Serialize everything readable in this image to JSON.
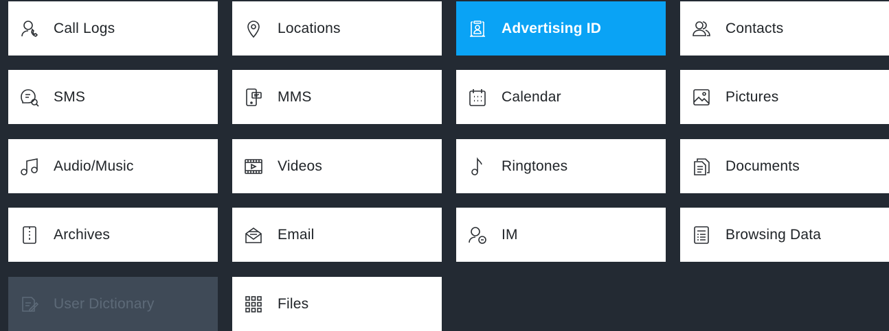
{
  "colors": {
    "background": "#232a33",
    "tile": "#ffffff",
    "selected": "#0aa3f5",
    "disabled": "#3f4a57"
  },
  "tiles": [
    {
      "label": "Call Logs",
      "icon": "call-logs-icon",
      "state": "normal"
    },
    {
      "label": "Locations",
      "icon": "location-pin-icon",
      "state": "normal"
    },
    {
      "label": "Advertising ID",
      "icon": "advertising-id-icon",
      "state": "selected"
    },
    {
      "label": "Contacts",
      "icon": "contacts-icon",
      "state": "normal"
    },
    {
      "label": "SMS",
      "icon": "sms-icon",
      "state": "normal"
    },
    {
      "label": "MMS",
      "icon": "mms-icon",
      "state": "normal"
    },
    {
      "label": "Calendar",
      "icon": "calendar-icon",
      "state": "normal"
    },
    {
      "label": "Pictures",
      "icon": "pictures-icon",
      "state": "normal"
    },
    {
      "label": "Audio/Music",
      "icon": "music-note-icon",
      "state": "normal"
    },
    {
      "label": "Videos",
      "icon": "video-film-icon",
      "state": "normal"
    },
    {
      "label": "Ringtones",
      "icon": "ringtone-note-icon",
      "state": "normal"
    },
    {
      "label": "Documents",
      "icon": "documents-icon",
      "state": "normal"
    },
    {
      "label": "Archives",
      "icon": "archive-icon",
      "state": "normal"
    },
    {
      "label": "Email",
      "icon": "email-envelope-icon",
      "state": "normal"
    },
    {
      "label": "IM",
      "icon": "instant-message-icon",
      "state": "normal"
    },
    {
      "label": "Browsing Data",
      "icon": "browsing-data-icon",
      "state": "normal"
    },
    {
      "label": "User Dictionary",
      "icon": "user-dictionary-icon",
      "state": "disabled"
    },
    {
      "label": "Files",
      "icon": "files-grid-icon",
      "state": "normal"
    }
  ]
}
